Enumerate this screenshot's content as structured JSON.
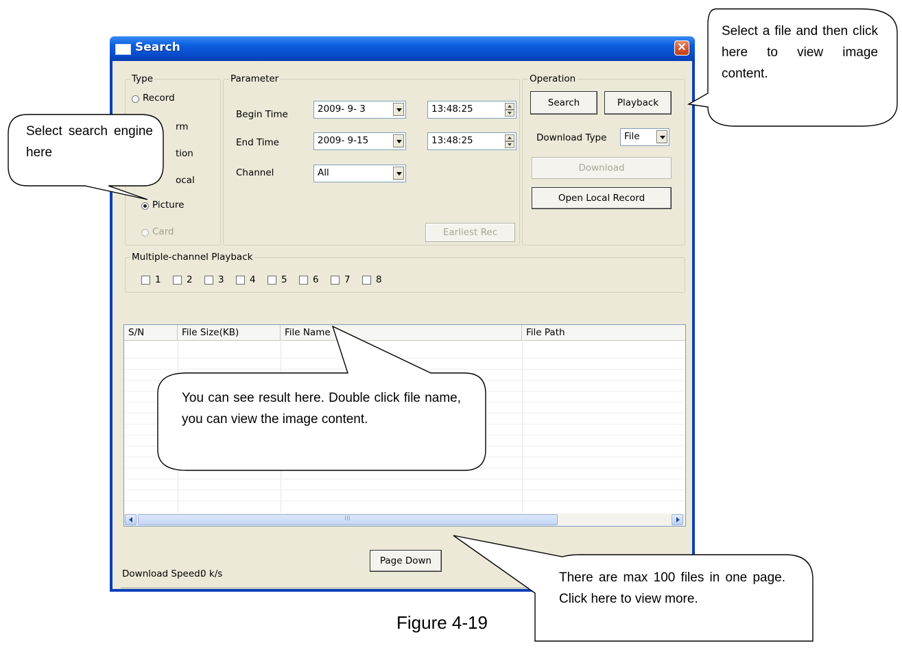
{
  "window": {
    "title": "Search",
    "close_glyph": "✕"
  },
  "type_group": {
    "legend": "Type",
    "options": [
      {
        "label": "Record",
        "selected": false,
        "enabled": true
      },
      {
        "label": "rm",
        "selected": false,
        "enabled": true
      },
      {
        "label": "tion",
        "selected": false,
        "enabled": true
      },
      {
        "label": "ocal",
        "selected": false,
        "enabled": true
      },
      {
        "label": "Picture",
        "selected": true,
        "enabled": true
      },
      {
        "label": "Card",
        "selected": false,
        "enabled": false
      }
    ]
  },
  "parameter_group": {
    "legend": "Parameter",
    "begin_time_label": "Begin Time",
    "begin_date": "2009- 9- 3",
    "begin_clock": "13:48:25",
    "end_time_label": "End Time",
    "end_date": "2009- 9-15",
    "end_clock": "13:48:25",
    "channel_label": "Channel",
    "channel_value": "All",
    "earliest_rec_label": "Earliest Rec"
  },
  "operation_group": {
    "legend": "Operation",
    "search_label": "Search",
    "playback_label": "Playback",
    "download_type_label": "Download Type",
    "download_type_value": "File",
    "download_label": "Download",
    "open_local_record_label": "Open Local Record"
  },
  "multi_channel": {
    "legend": "Multiple-channel Playback",
    "channels": [
      "1",
      "2",
      "3",
      "4",
      "5",
      "6",
      "7",
      "8"
    ]
  },
  "file_list": {
    "columns": [
      "S/N",
      "File Size(KB)",
      "File Name",
      "File Path"
    ],
    "scroll_grip": "III"
  },
  "footer": {
    "page_down_label": "Page Down",
    "download_speed_label": "Download Speed:",
    "download_speed_value": "0 k/s"
  },
  "callouts": {
    "operation": "Select a file and then click here to view image content.",
    "engine": "Select search engine here",
    "result": "You can see result here. Double click file name, you can view the image content.",
    "page": "There are max 100 files in one page. Click here to view more."
  },
  "figure_caption": "Figure 4-19"
}
